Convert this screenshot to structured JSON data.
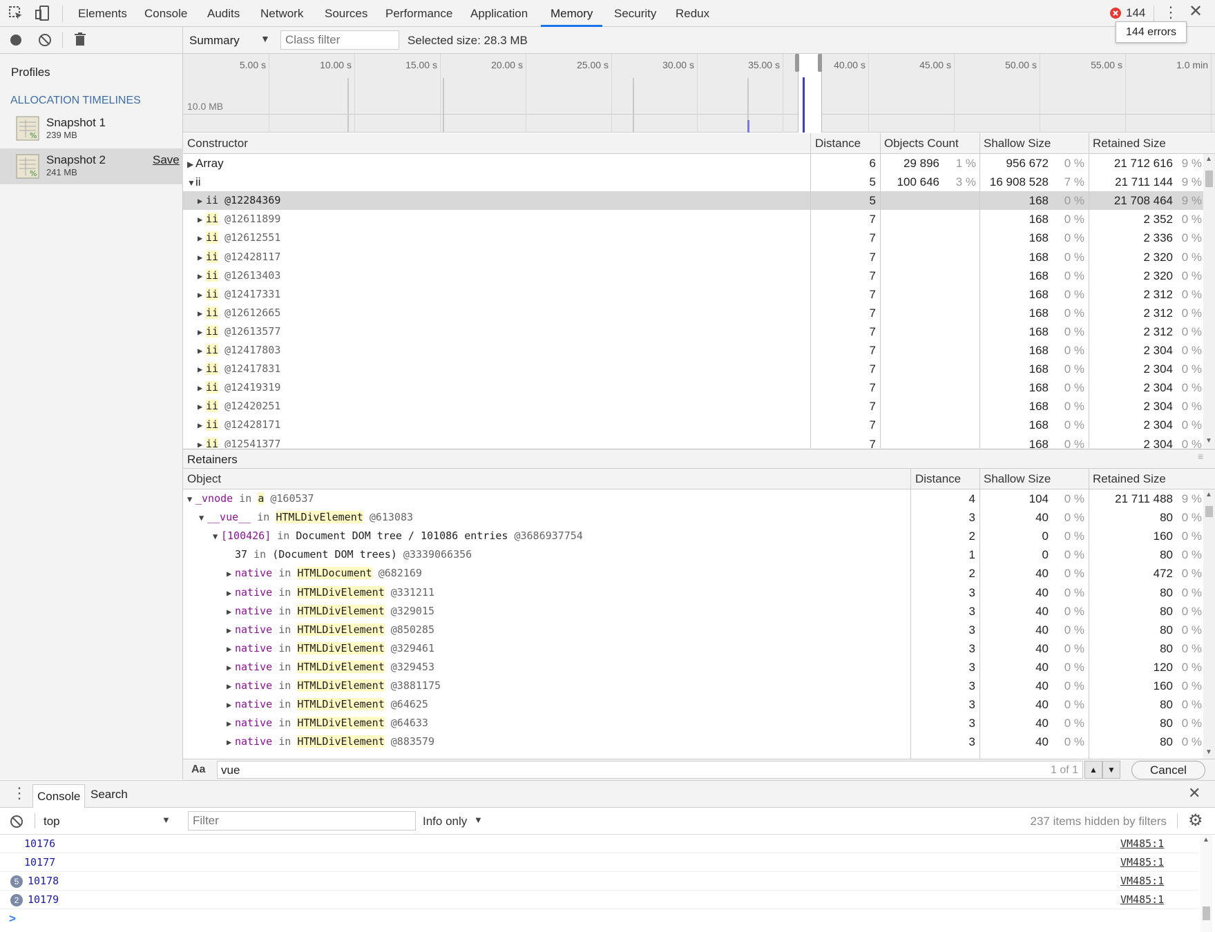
{
  "devtools": {
    "tabs": [
      "Elements",
      "Console",
      "Audits",
      "Network",
      "Sources",
      "Performance",
      "Application",
      "Memory",
      "Security",
      "Redux"
    ],
    "active_tab": "Memory",
    "error_count": "144",
    "error_tooltip": "144 errors"
  },
  "toolbar": {
    "view_select": "Summary",
    "class_filter_placeholder": "Class filter",
    "selected_size": "Selected size: 28.3 MB"
  },
  "sidebar": {
    "profiles_title": "Profiles",
    "section": "ALLOCATION TIMELINES",
    "snapshots": [
      {
        "name": "Snapshot 1",
        "size": "239 MB"
      },
      {
        "name": "Snapshot 2",
        "size": "241 MB",
        "save_label": "Save"
      }
    ]
  },
  "timeline": {
    "ticks": [
      "5.00 s",
      "10.00 s",
      "15.00 s",
      "20.00 s",
      "25.00 s",
      "30.00 s",
      "35.00 s",
      "40.00 s",
      "45.00 s",
      "50.00 s",
      "55.00 s",
      "1.0 min"
    ],
    "scale_label": "10.0 MB"
  },
  "constructor_table": {
    "headers": [
      "Constructor",
      "Distance",
      "Objects Count",
      "Shallow Size",
      "Retained Size"
    ],
    "rows": [
      {
        "name": "Array",
        "id": "",
        "expanded": false,
        "distance": "6",
        "count": "29 896",
        "count_pct": "1 %",
        "shallow": "956 672",
        "shallow_pct": "0 %",
        "retained": "21 712 616",
        "retained_pct": "9 %",
        "level": 0
      },
      {
        "name": "ii",
        "id": "",
        "expanded": true,
        "distance": "5",
        "count": "100 646",
        "count_pct": "3 %",
        "shallow": "16 908 528",
        "shallow_pct": "7 %",
        "retained": "21 711 144",
        "retained_pct": "9 %",
        "level": 0
      },
      {
        "name": "ii",
        "id": "@12284369",
        "distance": "5",
        "shallow": "168",
        "shallow_pct": "0 %",
        "retained": "21 708 464",
        "retained_pct": "9 %",
        "level": 1,
        "selected": true
      },
      {
        "name": "ii",
        "id": "@12611899",
        "distance": "7",
        "shallow": "168",
        "shallow_pct": "0 %",
        "retained": "2 352",
        "retained_pct": "0 %",
        "level": 1
      },
      {
        "name": "ii",
        "id": "@12612551",
        "distance": "7",
        "shallow": "168",
        "shallow_pct": "0 %",
        "retained": "2 336",
        "retained_pct": "0 %",
        "level": 1
      },
      {
        "name": "ii",
        "id": "@12428117",
        "distance": "7",
        "shallow": "168",
        "shallow_pct": "0 %",
        "retained": "2 320",
        "retained_pct": "0 %",
        "level": 1
      },
      {
        "name": "ii",
        "id": "@12613403",
        "distance": "7",
        "shallow": "168",
        "shallow_pct": "0 %",
        "retained": "2 320",
        "retained_pct": "0 %",
        "level": 1
      },
      {
        "name": "ii",
        "id": "@12417331",
        "distance": "7",
        "shallow": "168",
        "shallow_pct": "0 %",
        "retained": "2 312",
        "retained_pct": "0 %",
        "level": 1
      },
      {
        "name": "ii",
        "id": "@12612665",
        "distance": "7",
        "shallow": "168",
        "shallow_pct": "0 %",
        "retained": "2 312",
        "retained_pct": "0 %",
        "level": 1
      },
      {
        "name": "ii",
        "id": "@12613577",
        "distance": "7",
        "shallow": "168",
        "shallow_pct": "0 %",
        "retained": "2 312",
        "retained_pct": "0 %",
        "level": 1
      },
      {
        "name": "ii",
        "id": "@12417803",
        "distance": "7",
        "shallow": "168",
        "shallow_pct": "0 %",
        "retained": "2 304",
        "retained_pct": "0 %",
        "level": 1
      },
      {
        "name": "ii",
        "id": "@12417831",
        "distance": "7",
        "shallow": "168",
        "shallow_pct": "0 %",
        "retained": "2 304",
        "retained_pct": "0 %",
        "level": 1
      },
      {
        "name": "ii",
        "id": "@12419319",
        "distance": "7",
        "shallow": "168",
        "shallow_pct": "0 %",
        "retained": "2 304",
        "retained_pct": "0 %",
        "level": 1
      },
      {
        "name": "ii",
        "id": "@12420251",
        "distance": "7",
        "shallow": "168",
        "shallow_pct": "0 %",
        "retained": "2 304",
        "retained_pct": "0 %",
        "level": 1
      },
      {
        "name": "ii",
        "id": "@12428171",
        "distance": "7",
        "shallow": "168",
        "shallow_pct": "0 %",
        "retained": "2 304",
        "retained_pct": "0 %",
        "level": 1
      },
      {
        "name": "ii",
        "id": "@12541377",
        "distance": "7",
        "shallow": "168",
        "shallow_pct": "0 %",
        "retained": "2 304",
        "retained_pct": "0 %",
        "level": 1
      }
    ]
  },
  "retainers": {
    "title": "Retainers",
    "headers": [
      "Object",
      "Distance",
      "Shallow Size",
      "Retained Size"
    ],
    "rows": [
      {
        "prop": "_vnode",
        "in": "in",
        "cls": "a",
        "id": "@160537",
        "distance": "4",
        "shallow": "104",
        "shallow_pct": "0 %",
        "retained": "21 711 488",
        "retained_pct": "9 %",
        "level": 0,
        "arrow": "down"
      },
      {
        "prop": "__vue__",
        "in": "in",
        "cls": "HTMLDivElement",
        "id": "@613083",
        "distance": "3",
        "shallow": "40",
        "shallow_pct": "0 %",
        "retained": "80",
        "retained_pct": "0 %",
        "level": 1,
        "arrow": "down"
      },
      {
        "prop": "[100426]",
        "in": "in",
        "cls": "Document DOM tree / 101086 entries",
        "id": "@3686937754",
        "distance": "2",
        "shallow": "0",
        "shallow_pct": "0 %",
        "retained": "160",
        "retained_pct": "0 %",
        "level": 2,
        "arrow": "down",
        "plaincls": true
      },
      {
        "prop": "37",
        "in": "in",
        "cls": "(Document DOM trees)",
        "id": "@3339066356",
        "distance": "1",
        "shallow": "0",
        "shallow_pct": "0 %",
        "retained": "80",
        "retained_pct": "0 %",
        "level": 3,
        "arrow": "none",
        "plaincls": true,
        "plainprop": true
      },
      {
        "prop": "native",
        "in": "in",
        "cls": "HTMLDocument",
        "id": "@682169",
        "distance": "2",
        "shallow": "40",
        "shallow_pct": "0 %",
        "retained": "472",
        "retained_pct": "0 %",
        "level": 3,
        "arrow": "right"
      },
      {
        "prop": "native",
        "in": "in",
        "cls": "HTMLDivElement",
        "id": "@331211",
        "distance": "3",
        "shallow": "40",
        "shallow_pct": "0 %",
        "retained": "80",
        "retained_pct": "0 %",
        "level": 3,
        "arrow": "right"
      },
      {
        "prop": "native",
        "in": "in",
        "cls": "HTMLDivElement",
        "id": "@329015",
        "distance": "3",
        "shallow": "40",
        "shallow_pct": "0 %",
        "retained": "80",
        "retained_pct": "0 %",
        "level": 3,
        "arrow": "right"
      },
      {
        "prop": "native",
        "in": "in",
        "cls": "HTMLDivElement",
        "id": "@850285",
        "distance": "3",
        "shallow": "40",
        "shallow_pct": "0 %",
        "retained": "80",
        "retained_pct": "0 %",
        "level": 3,
        "arrow": "right"
      },
      {
        "prop": "native",
        "in": "in",
        "cls": "HTMLDivElement",
        "id": "@329461",
        "distance": "3",
        "shallow": "40",
        "shallow_pct": "0 %",
        "retained": "80",
        "retained_pct": "0 %",
        "level": 3,
        "arrow": "right"
      },
      {
        "prop": "native",
        "in": "in",
        "cls": "HTMLDivElement",
        "id": "@329453",
        "distance": "3",
        "shallow": "40",
        "shallow_pct": "0 %",
        "retained": "120",
        "retained_pct": "0 %",
        "level": 3,
        "arrow": "right"
      },
      {
        "prop": "native",
        "in": "in",
        "cls": "HTMLDivElement",
        "id": "@3881175",
        "distance": "3",
        "shallow": "40",
        "shallow_pct": "0 %",
        "retained": "160",
        "retained_pct": "0 %",
        "level": 3,
        "arrow": "right"
      },
      {
        "prop": "native",
        "in": "in",
        "cls": "HTMLDivElement",
        "id": "@64625",
        "distance": "3",
        "shallow": "40",
        "shallow_pct": "0 %",
        "retained": "80",
        "retained_pct": "0 %",
        "level": 3,
        "arrow": "right"
      },
      {
        "prop": "native",
        "in": "in",
        "cls": "HTMLDivElement",
        "id": "@64633",
        "distance": "3",
        "shallow": "40",
        "shallow_pct": "0 %",
        "retained": "80",
        "retained_pct": "0 %",
        "level": 3,
        "arrow": "right"
      },
      {
        "prop": "native",
        "in": "in",
        "cls": "HTMLDivElement",
        "id": "@883579",
        "distance": "3",
        "shallow": "40",
        "shallow_pct": "0 %",
        "retained": "80",
        "retained_pct": "0 %",
        "level": 3,
        "arrow": "right"
      }
    ]
  },
  "search": {
    "case_label": "Aa",
    "value": "vue",
    "match_count": "1 of 1",
    "cancel_label": "Cancel"
  },
  "console": {
    "tabs": [
      "Console",
      "Search"
    ],
    "context": "top",
    "filter_placeholder": "Filter",
    "level": "Info only",
    "hidden_text": "237 items hidden by filters",
    "messages": [
      {
        "text": "10176",
        "repeat": "",
        "source": "VM485:1"
      },
      {
        "text": "10177",
        "repeat": "",
        "source": "VM485:1"
      },
      {
        "text": "10178",
        "repeat": "5",
        "source": "VM485:1"
      },
      {
        "text": "10179",
        "repeat": "2",
        "source": "VM485:1"
      }
    ],
    "prompt": ">"
  }
}
